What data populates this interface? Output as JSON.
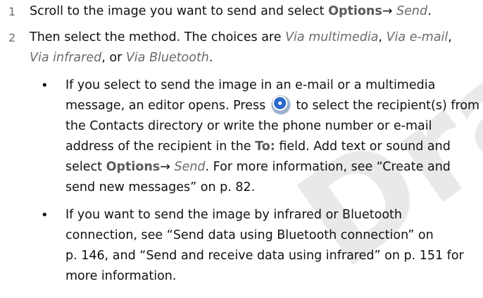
{
  "watermark": "Draft",
  "steps": [
    {
      "number": "1",
      "line1": {
        "a": "Scroll to the image you want to send and select ",
        "ui1": "Options",
        "arrow": "→ ",
        "opt1": "Send",
        "end": "."
      }
    },
    {
      "number": "2",
      "line1": {
        "a": "Then select the method. The choices are ",
        "opt1": "Via multimedia",
        "b": ", ",
        "opt2": "Via e-mail",
        "c": ","
      },
      "line2": {
        "opt1": "Via infrared",
        "b": ", or ",
        "opt2": "Via Bluetooth",
        "end": "."
      }
    }
  ],
  "bullets": [
    {
      "symbol": "•",
      "lines": [
        {
          "text": "If you select to send the image in an e-mail or a multimedia"
        },
        {
          "a": "message, an editor opens. Press ",
          "icon": "navigation-key-icon",
          "b": " to select the recipient(s) from"
        },
        {
          "text": "the Contacts directory or write the phone number or e-mail"
        },
        {
          "a": "address of the recipient in the ",
          "ui1": "To:",
          "b": " field. Add text or sound and"
        },
        {
          "a": "select ",
          "ui1": "Options",
          "arrow": "→ ",
          "opt1": "Send",
          "b": ". For more information, see “Create and"
        },
        {
          "text": "send new messages” on p. 82."
        }
      ]
    },
    {
      "symbol": "•",
      "lines": [
        {
          "text": "If you want to send the image by infrared or Bluetooth"
        },
        {
          "text": "connection, see “Send data using Bluetooth connection” on"
        },
        {
          "text": "p. 146, and “Send and receive data using infrared” on p. 151 for"
        },
        {
          "text": "more information."
        }
      ]
    }
  ]
}
